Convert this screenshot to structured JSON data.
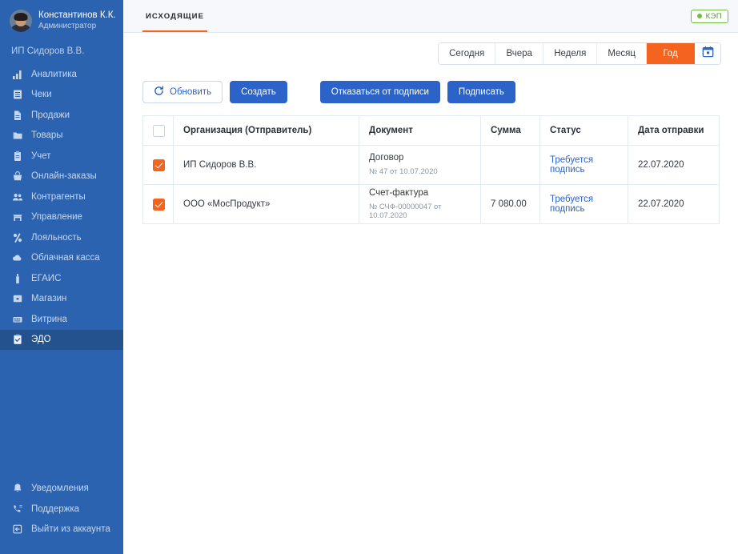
{
  "sidebar": {
    "user": {
      "name": "Константинов К.К.",
      "role": "Администратор",
      "avatar_icon": "user-avatar-photo"
    },
    "organization": "ИП Сидоров В.В.",
    "items": [
      {
        "label": "Аналитика",
        "icon": "bar-chart-icon",
        "active": false
      },
      {
        "label": "Чеки",
        "icon": "receipt-icon",
        "active": false
      },
      {
        "label": "Продажи",
        "icon": "document-icon",
        "active": false
      },
      {
        "label": "Товары",
        "icon": "folder-icon",
        "active": false
      },
      {
        "label": "Учет",
        "icon": "clipboard-icon",
        "active": false
      },
      {
        "label": "Онлайн-заказы",
        "icon": "basket-icon",
        "active": false
      },
      {
        "label": "Контрагенты",
        "icon": "users-icon",
        "active": false
      },
      {
        "label": "Управление",
        "icon": "store-icon",
        "active": false
      },
      {
        "label": "Лояльность",
        "icon": "percent-icon",
        "active": false
      },
      {
        "label": "Облачная касса",
        "icon": "cloud-icon",
        "active": false
      },
      {
        "label": "ЕГАИС",
        "icon": "bottle-icon",
        "active": false
      },
      {
        "label": "Магазин",
        "icon": "shop-box-icon",
        "active": false
      },
      {
        "label": "Витрина",
        "icon": "showcase-icon",
        "active": false
      },
      {
        "label": "ЭДО",
        "icon": "edo-clipboard-icon",
        "active": true
      }
    ],
    "bottom_items": [
      {
        "label": "Уведомления",
        "icon": "bell-icon"
      },
      {
        "label": "Поддержка",
        "icon": "phone-support-icon"
      },
      {
        "label": "Выйти из аккаунта",
        "icon": "logout-icon"
      }
    ]
  },
  "topbar": {
    "tabs": [
      {
        "label": "ИСХОДЯЩИЕ",
        "active": true
      }
    ],
    "badge": {
      "label": "КЭП",
      "dot_icon": "status-dot-icon",
      "color": "#6fbf3f"
    }
  },
  "filters": {
    "buttons": [
      {
        "label": "Сегодня",
        "active": false
      },
      {
        "label": "Вчера",
        "active": false
      },
      {
        "label": "Неделя",
        "active": false
      },
      {
        "label": "Месяц",
        "active": false
      },
      {
        "label": "Год",
        "active": true
      }
    ],
    "calendar_icon": "calendar-icon",
    "active_color": "#f4641e"
  },
  "actions": {
    "refresh": {
      "label": "Обновить",
      "icon": "refresh-icon"
    },
    "create": {
      "label": "Создать"
    },
    "decline": {
      "label": "Отказаться от подписи"
    },
    "sign": {
      "label": "Подписать"
    },
    "primary_color": "#2c63c8"
  },
  "table": {
    "columns": [
      "Организация (Отправитель)",
      "Документ",
      "Сумма",
      "Статус",
      "Дата отправки"
    ],
    "header_checkbox_checked": false,
    "rows": [
      {
        "checked": true,
        "org": "ИП Сидоров В.В.",
        "doc_title": "Договор",
        "doc_sub": "№ 47 от 10.07.2020",
        "sum": "",
        "status": "Требуется подпись",
        "date": "22.07.2020"
      },
      {
        "checked": true,
        "org": "ООО «МосПродукт»",
        "doc_title": "Счет-фактура",
        "doc_sub": "№ СЧФ-00000047 от 10.07.2020",
        "sum": "7 080.00",
        "status": "Требуется подпись",
        "date": "22.07.2020"
      }
    ]
  }
}
